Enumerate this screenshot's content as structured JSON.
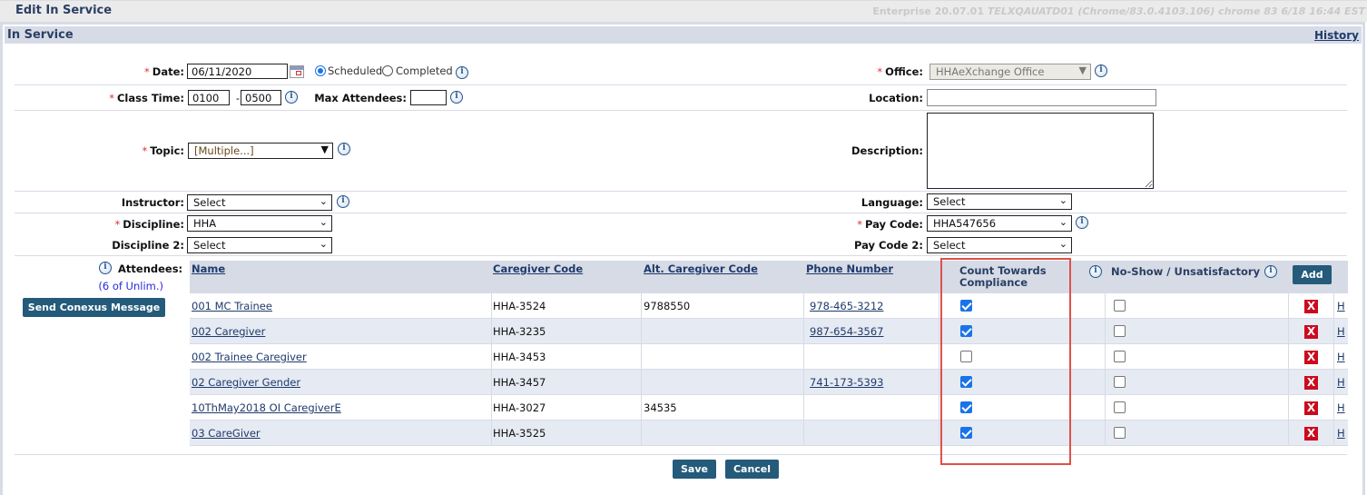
{
  "header": {
    "title": "Edit In Service",
    "version": "Enterprise 20.07.01",
    "version_detail": "TELXQAUATD01 (Chrome/83.0.4103.106) chrome 83 6/18 16:44 EST"
  },
  "section": {
    "title": "In Service",
    "history_link": "History"
  },
  "form": {
    "date": {
      "label": "Date:",
      "value": "06/11/2020",
      "required": true
    },
    "status": {
      "options": [
        "Scheduled",
        "Completed"
      ],
      "selected": "Scheduled"
    },
    "office": {
      "label": "Office:",
      "value": "HHAeXchange Office",
      "required": true,
      "disabled": true
    },
    "class_time": {
      "label": "Class Time:",
      "from": "0100",
      "separator": "-",
      "to": "0500",
      "required": true
    },
    "max_attendees": {
      "label": "Max Attendees:",
      "value": ""
    },
    "location": {
      "label": "Location:",
      "value": ""
    },
    "topic": {
      "label": "Topic:",
      "value": "[Multiple...]",
      "required": true
    },
    "description": {
      "label": "Description:",
      "value": ""
    },
    "instructor": {
      "label": "Instructor:",
      "value": "Select"
    },
    "language": {
      "label": "Language:",
      "value": "Select"
    },
    "discipline": {
      "label": "Discipline:",
      "value": "HHA",
      "required": true
    },
    "pay_code": {
      "label": "Pay Code:",
      "value": "HHA547656",
      "required": true
    },
    "discipline2": {
      "label": "Discipline 2:",
      "value": "Select"
    },
    "pay_code2": {
      "label": "Pay Code 2:",
      "value": "Select"
    }
  },
  "attendees": {
    "label": "Attendees:",
    "count": "(6 of Unlim.)",
    "send_button": "Send Conexus Message",
    "add_button": "Add",
    "columns": {
      "name": "Name",
      "caregiver_code": "Caregiver Code",
      "alt_code": "Alt. Caregiver Code",
      "phone": "Phone Number",
      "compliance": "Count Towards Compliance",
      "noshow": "No-Show / Unsatisfactory"
    },
    "history_link": "H",
    "delete_icon": "X",
    "rows": [
      {
        "name": "001 MC Trainee",
        "code": "HHA-3524",
        "alt_code": "9788550",
        "phone": "978-465-3212",
        "compliance": true,
        "noshow": false
      },
      {
        "name": "002 Caregiver",
        "code": "HHA-3235",
        "alt_code": "",
        "phone": "987-654-3567",
        "compliance": true,
        "noshow": false
      },
      {
        "name": "002 Trainee Caregiver",
        "code": "HHA-3453",
        "alt_code": "",
        "phone": "",
        "compliance": false,
        "noshow": false
      },
      {
        "name": "02 Caregiver Gender",
        "code": "HHA-3457",
        "alt_code": "",
        "phone": "741-173-5393",
        "compliance": true,
        "noshow": false
      },
      {
        "name": "10ThMay2018 OI CaregiverE",
        "code": "HHA-3027",
        "alt_code": "34535",
        "phone": "",
        "compliance": true,
        "noshow": false
      },
      {
        "name": "03 CareGiver",
        "code": "HHA-3525",
        "alt_code": "",
        "phone": "",
        "compliance": true,
        "noshow": false
      }
    ]
  },
  "footer": {
    "save": "Save",
    "cancel": "Cancel"
  },
  "colors": {
    "accent": "#245a7a",
    "header_band": "#d6dbe6",
    "delete": "#cc0a1e",
    "highlight_box": "#e0504a",
    "checkbox": "#1a73e8"
  }
}
